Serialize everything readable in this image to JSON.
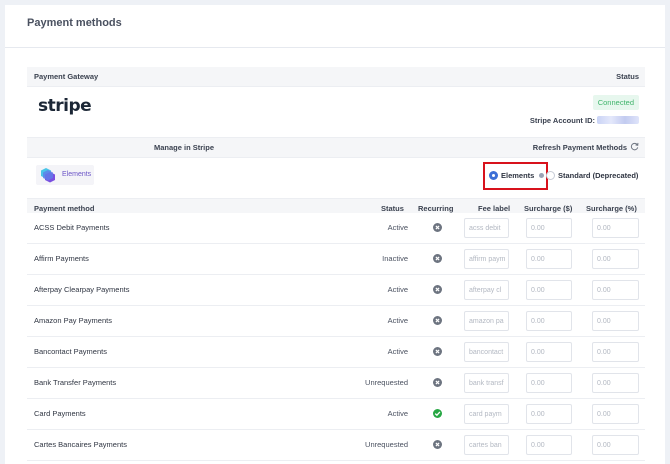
{
  "page": {
    "title": "Payment methods"
  },
  "gateway": {
    "header_label": "Payment Gateway",
    "status_header": "Status",
    "logo_text": "stripe",
    "status_badge": "Connected",
    "account_label": "Stripe Account ID:"
  },
  "manage": {
    "manage_label": "Manage in Stripe",
    "refresh_label": "Refresh Payment Methods",
    "elements_badge": "Elements",
    "option_elements": "Elements",
    "option_standard": "Standard (Deprecated)",
    "selected": "Elements"
  },
  "table": {
    "headers": {
      "method": "Payment method",
      "status": "Status",
      "recurring": "Recurring",
      "fee_label": "Fee label",
      "surcharge_fixed": "Surcharge ($)",
      "surcharge_pct": "Surcharge (%)"
    },
    "rows": [
      {
        "name": "ACSS Debit Payments",
        "status": "Active",
        "recurring": false,
        "fee_placeholder": "acss debit",
        "s1": "0.00",
        "s2": "0.00"
      },
      {
        "name": "Affirm Payments",
        "status": "Inactive",
        "recurring": false,
        "fee_placeholder": "affirm paym",
        "s1": "0.00",
        "s2": "0.00"
      },
      {
        "name": "Afterpay Clearpay Payments",
        "status": "Active",
        "recurring": false,
        "fee_placeholder": "afterpay cl",
        "s1": "0.00",
        "s2": "0.00"
      },
      {
        "name": "Amazon Pay Payments",
        "status": "Active",
        "recurring": false,
        "fee_placeholder": "amazon pa",
        "s1": "0.00",
        "s2": "0.00"
      },
      {
        "name": "Bancontact Payments",
        "status": "Active",
        "recurring": false,
        "fee_placeholder": "bancontact",
        "s1": "0.00",
        "s2": "0.00"
      },
      {
        "name": "Bank Transfer Payments",
        "status": "Unrequested",
        "recurring": false,
        "fee_placeholder": "bank transf",
        "s1": "0.00",
        "s2": "0.00"
      },
      {
        "name": "Card Payments",
        "status": "Active",
        "recurring": true,
        "fee_placeholder": "card paym",
        "s1": "0.00",
        "s2": "0.00"
      },
      {
        "name": "Cartes Bancaires Payments",
        "status": "Unrequested",
        "recurring": false,
        "fee_placeholder": "cartes ban",
        "s1": "0.00",
        "s2": "0.00"
      }
    ]
  },
  "colors": {
    "accent": "#3d6fd6",
    "connected": "#3fb46b",
    "highlight": "#d8121c",
    "recurring_on": "#27a744",
    "recurring_off": "#6d7480"
  }
}
